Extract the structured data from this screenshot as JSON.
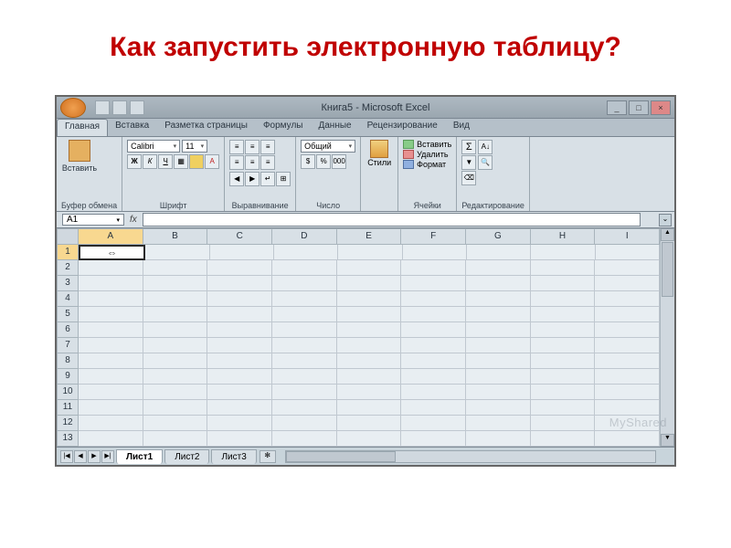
{
  "slide": {
    "title": "Как запустить электронную таблицу?"
  },
  "window": {
    "title": "Книга5 - Microsoft Excel"
  },
  "tabs": {
    "items": [
      "Главная",
      "Вставка",
      "Разметка страницы",
      "Формулы",
      "Данные",
      "Рецензирование",
      "Вид"
    ],
    "active": 0
  },
  "ribbon": {
    "clipboard": {
      "paste": "Вставить",
      "label": "Буфер обмена"
    },
    "font": {
      "name": "Calibri",
      "size": "11",
      "label": "Шрифт"
    },
    "alignment": {
      "label": "Выравнивание"
    },
    "number": {
      "format": "Общий",
      "label": "Число"
    },
    "styles": {
      "btn": "Стили",
      "label": ""
    },
    "cells": {
      "insert": "Вставить",
      "delete": "Удалить",
      "format": "Формат",
      "label": "Ячейки"
    },
    "editing": {
      "label": "Редактирование"
    }
  },
  "namebox": {
    "value": "A1"
  },
  "columns": [
    "A",
    "B",
    "C",
    "D",
    "E",
    "F",
    "G",
    "H",
    "I"
  ],
  "rows": [
    "1",
    "2",
    "3",
    "4",
    "5",
    "6",
    "7",
    "8",
    "9",
    "10",
    "11",
    "12",
    "13"
  ],
  "activeCell": {
    "col": 0,
    "row": 0
  },
  "sheets": {
    "items": [
      "Лист1",
      "Лист2",
      "Лист3"
    ],
    "active": 0
  },
  "watermark": "MyShared"
}
